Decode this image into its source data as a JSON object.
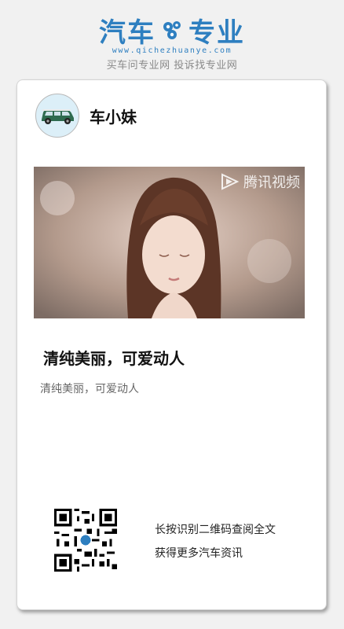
{
  "logo": {
    "left": "汽车",
    "right": "专业",
    "url": "www.qichezhuanye.com",
    "tagline": "买车问专业网 投诉找专业网",
    "brand_color": "#2e7fc0",
    "gear_icon": "gear-icon"
  },
  "author": {
    "name": "车小妹",
    "avatar_icon": "car-icon"
  },
  "hero": {
    "watermark": "腾讯视频"
  },
  "article": {
    "title": "清纯美丽，可爱动人",
    "description": "清纯美丽，可爱动人"
  },
  "footer": {
    "qr_line1": "长按识别二维码查阅全文",
    "qr_line2": "获得更多汽车资讯"
  }
}
